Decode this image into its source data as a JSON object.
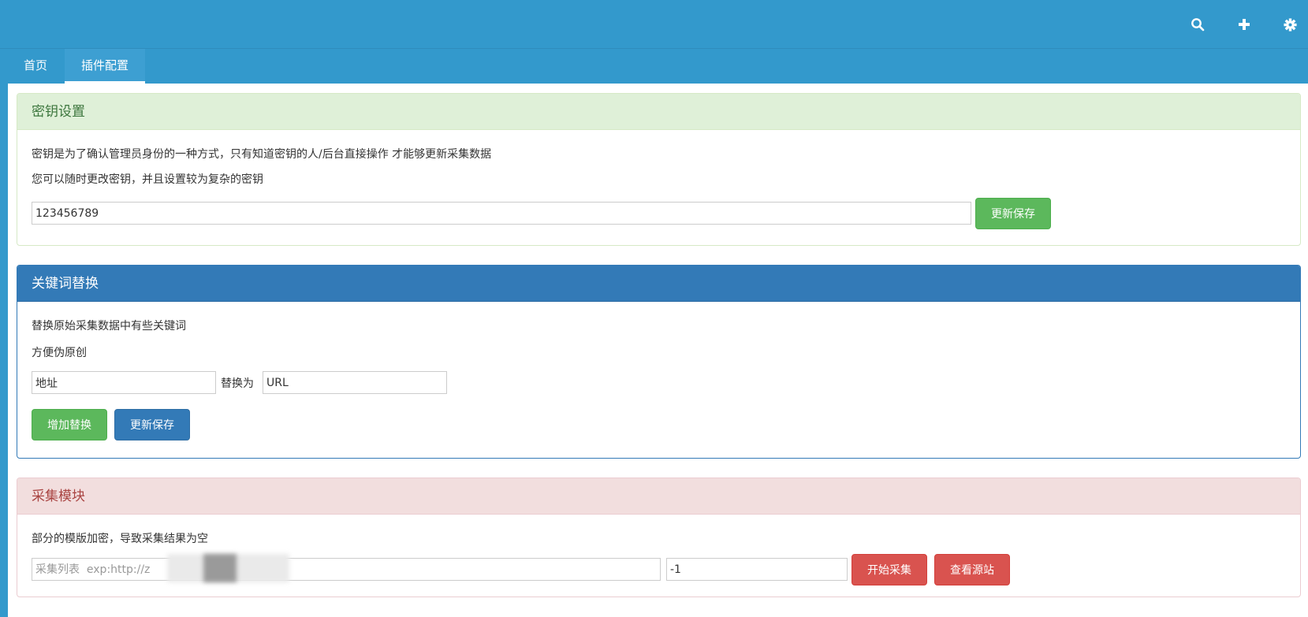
{
  "header": {
    "icons": [
      "search-icon",
      "plus-icon",
      "gear-icon"
    ]
  },
  "tabs": [
    {
      "label": "首页",
      "active": false
    },
    {
      "label": "插件配置",
      "active": true
    }
  ],
  "key_panel": {
    "title": "密钥设置",
    "desc1": "密钥是为了确认管理员身份的一种方式，只有知道密钥的人/后台直接操作 才能够更新采集数据",
    "desc2": "您可以随时更改密钥，并且设置较为复杂的密钥",
    "key_value": "123456789",
    "save_label": "更新保存"
  },
  "replace_panel": {
    "title": "关键词替换",
    "desc1": "替换原始采集数据中有些关键词",
    "desc2": "方便伪原创",
    "from_value": "地址",
    "replace_with_label": "替换为",
    "to_value": "URL",
    "add_label": "增加替换",
    "save_label": "更新保存"
  },
  "collect_panel": {
    "title": "采集模块",
    "desc": "部分的模版加密，导致采集结果为空",
    "list_placeholder": "采集列表  exp:http://z",
    "count_value": "-1",
    "start_label": "开始采集",
    "view_source_label": "查看源站"
  },
  "colors": {
    "brand": "#3399cc",
    "success": "#5cb85c",
    "primary": "#337ab7",
    "danger": "#d9534f"
  }
}
